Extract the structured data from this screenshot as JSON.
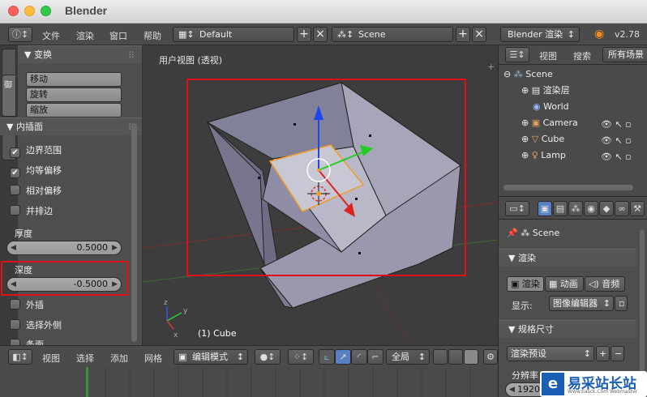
{
  "window": {
    "title": "Blender"
  },
  "topbar": {
    "menus": [
      "文件",
      "渲染",
      "窗口",
      "帮助"
    ],
    "layout": "Default",
    "scene": "Scene",
    "engine": "Blender 渲染",
    "version": "v2.78"
  },
  "tools": {
    "transform": {
      "header": "▼ 变换",
      "buttons": [
        "移动",
        "旋转",
        "缩放"
      ]
    },
    "inset": {
      "header": "▼ 内插面",
      "checks": [
        {
          "label": "边界范围",
          "checked": true
        },
        {
          "label": "均等偏移",
          "checked": true
        },
        {
          "label": "相对偏移",
          "checked": false
        },
        {
          "label": "并排边",
          "checked": false
        }
      ],
      "thickness": {
        "label": "厚度",
        "value": "0.5000"
      },
      "depth": {
        "label": "深度",
        "value": "-0.5000"
      },
      "checks2": [
        {
          "label": "外插",
          "checked": false
        },
        {
          "label": "选择外侧",
          "checked": false
        },
        {
          "label": "条面",
          "checked": false
        }
      ]
    }
  },
  "viewport": {
    "title": "用户视图 (透视)",
    "object": "(1) Cube"
  },
  "bottombar": {
    "menus": [
      "视图",
      "选择",
      "添加",
      "网格"
    ],
    "mode": "编辑模式",
    "pivot": "全局"
  },
  "outliner": {
    "menus": [
      "视图",
      "搜索",
      "所有场景"
    ],
    "items": [
      {
        "label": "Scene",
        "icon": "scene-icon"
      },
      {
        "label": "渲染层",
        "icon": "render-layer-icon"
      },
      {
        "label": "World",
        "icon": "world-icon"
      },
      {
        "label": "Camera",
        "icon": "camera-icon"
      },
      {
        "label": "Cube",
        "icon": "mesh-icon"
      },
      {
        "label": "Lamp",
        "icon": "lamp-icon"
      }
    ]
  },
  "properties": {
    "scene": "Scene",
    "render_header": "▼ 渲染",
    "buttons": [
      "渲染",
      "动画",
      "音频"
    ],
    "display_label": "显示:",
    "display_value": "图像编辑器",
    "dimensions_header": "▼ 规格尺寸",
    "preset": "渲染预设",
    "resolution_label": "分辨率",
    "resolution_x": "1920"
  },
  "watermark": {
    "text": "易采站长站",
    "subtext": "Www.Easck.Com Webmaster"
  },
  "colors": {
    "highlight": "#e0101a",
    "accent": "#5680c2"
  }
}
